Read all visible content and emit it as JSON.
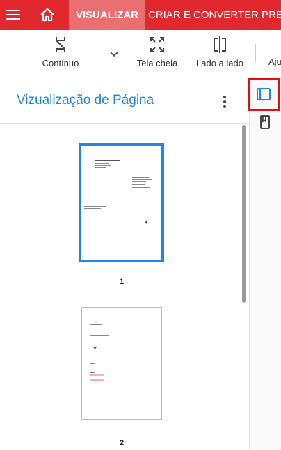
{
  "topbar": {
    "tabs": [
      {
        "label": "VISUALIZAR",
        "active": true
      },
      {
        "label": "CRIAR E CONVERTER",
        "active": false
      },
      {
        "label": "PRE",
        "active": false
      }
    ],
    "menu_icon": "hamburger-menu-icon",
    "home_icon": "home-icon",
    "colors": {
      "bar": "#e1282e",
      "active_tab": "#ea6f73"
    }
  },
  "toolbar": {
    "continuous_label": "Contínuo",
    "fullscreen_label": "Tela cheia",
    "side_by_side_label": "Lado a lado",
    "help_label": "Aju"
  },
  "panel": {
    "title": "Vizualização de Página",
    "pages": [
      {
        "number": "1",
        "selected": true
      },
      {
        "number": "2",
        "selected": false
      }
    ],
    "accent": "#1e88d6"
  },
  "rail": {
    "thumbnails_icon": "page-thumbnails-icon",
    "bookmarks_icon": "bookmark-icon",
    "highlight": "#e30d17"
  }
}
